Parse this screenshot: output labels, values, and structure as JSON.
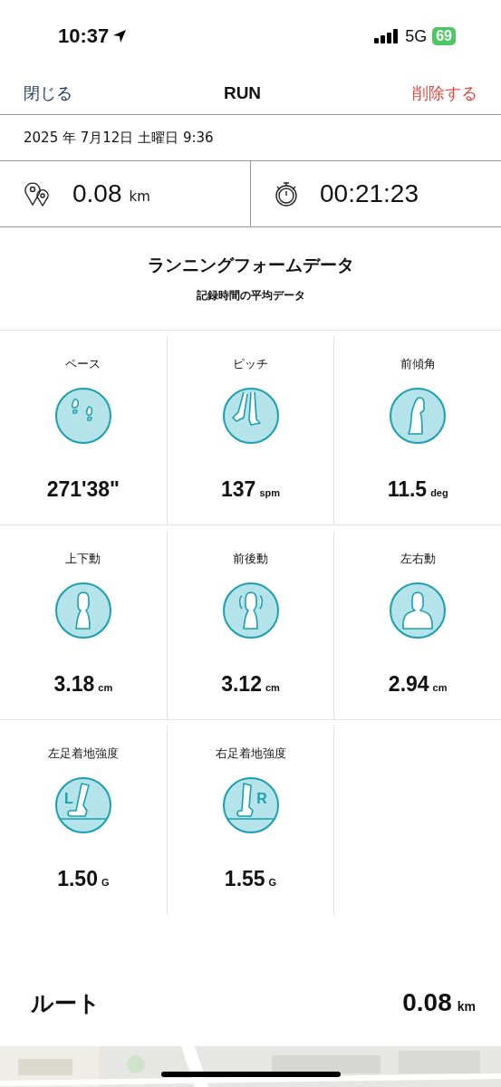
{
  "status_bar": {
    "time": "10:37",
    "network": "5G",
    "battery": "69"
  },
  "nav": {
    "close": "閉じる",
    "title": "RUN",
    "delete": "削除する"
  },
  "date": "2025 年 7月12日 土曜日 9:36",
  "summary": [
    {
      "kind": "distance",
      "value": "0.08",
      "unit": "km"
    },
    {
      "kind": "duration",
      "value": "00:21:23"
    }
  ],
  "form": {
    "title": "ランニングフォームデータ",
    "subtitle": "記録時間の平均データ"
  },
  "metrics": [
    {
      "kind": "pace",
      "label": "ペース",
      "value": "271'38\""
    },
    {
      "kind": "pitch",
      "label": "ピッチ",
      "value": "137",
      "unit": "spm"
    },
    {
      "kind": "lean",
      "label": "前傾角",
      "value": "11.5",
      "unit": "deg"
    },
    {
      "kind": "vertical",
      "label": "上下動",
      "value": "3.18",
      "unit": "cm"
    },
    {
      "kind": "front_back",
      "label": "前後動",
      "value": "3.12",
      "unit": "cm"
    },
    {
      "kind": "side",
      "label": "左右動",
      "value": "2.94",
      "unit": "cm"
    },
    {
      "kind": "foot_left",
      "label": "左足着地強度",
      "icon_letter": "L",
      "value": "1.50",
      "unit": "G"
    },
    {
      "kind": "foot_right",
      "label": "右足着地強度",
      "icon_letter": "R",
      "value": "1.55",
      "unit": "G"
    }
  ],
  "route": {
    "label": "ルート",
    "value": "0.08",
    "unit": "km"
  }
}
